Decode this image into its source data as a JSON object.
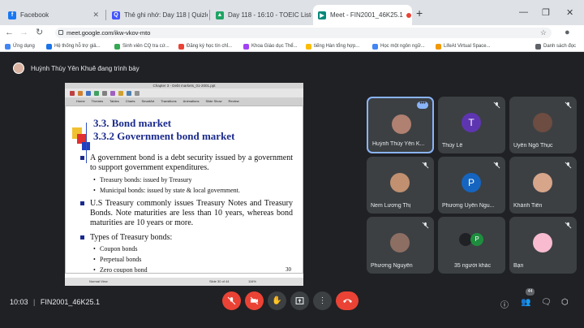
{
  "tabs": [
    {
      "title": "Facebook",
      "icon": "facebook-icon",
      "color": "#1877f2",
      "glyph": "f"
    },
    {
      "title": "Thẻ ghi nhớ: Day 118 | Quizlet",
      "icon": "quizlet-icon",
      "color": "#4255ff",
      "glyph": "Q"
    },
    {
      "title": "Day 118 - 16:10 - TOEIC Listening",
      "icon": "drive-icon",
      "color": "#1fa463",
      "glyph": "▲"
    },
    {
      "title": "Meet - FIN2001_46K25.1",
      "icon": "meet-icon",
      "color": "#00897b",
      "glyph": "▶"
    }
  ],
  "address": {
    "url": "meet.google.com/ikw-vkov-mto"
  },
  "bookmarks": [
    {
      "label": "Ứng dụng",
      "color": "#4285f4"
    },
    {
      "label": "Hệ thống hỗ trợ giả...",
      "color": "#1a73e8"
    },
    {
      "label": "Sinh viên CQ tra cứ...",
      "color": "#34a853"
    },
    {
      "label": "Đăng ký học tín chỉ...",
      "color": "#ea4335"
    },
    {
      "label": "Khoa Giáo dục Thể...",
      "color": "#a142f4"
    },
    {
      "label": "tiếng Hàn tổng hợp...",
      "color": "#fbbc04"
    },
    {
      "label": "Học một ngôn ngữ...",
      "color": "#4285f4"
    },
    {
      "label": "LifeAt Virtual Space...",
      "color": "#f29900"
    },
    {
      "label": "Danh sách đọc",
      "color": "#5f6368"
    }
  ],
  "banner": "Huỳnh Thùy Yên Khuê đang trình bày",
  "slide": {
    "window_title": "Chapter 3 - Debt markets_01-2001.ppt",
    "ribbon": [
      "Home",
      "Themes",
      "Tables",
      "Charts",
      "SmartArt",
      "Transitions",
      "Animations",
      "Slide Show",
      "Review"
    ],
    "h1": "3.3. Bond market",
    "h2": "3.3.2 Government bond market",
    "b1": "A government bond is a debt security issued by a government to support government expenditures.",
    "s1": "Treasury bonds: issued by Treasury",
    "s2": "Municipal bonds: issued by state & local government.",
    "b2": "U.S Treasury commonly issues Treasury Notes and Treasury Bonds. Note maturities are less than 10 years, whereas bond maturities are 10 years or more.",
    "b3": "Types of Treasury bonds:",
    "s3": "Coupon bonds",
    "s4": "Perpetual bonds",
    "s5": "Zero coupon bond",
    "page": "30",
    "status_view": "Normal View",
    "status_slide": "Slide 30 of 44",
    "status_zoom": "116%"
  },
  "participants": [
    {
      "name": "Huỳnh Thùy Yên K...",
      "avatar": "photo",
      "color": "#b08070",
      "speaking": true
    },
    {
      "name": "Thùy Lê",
      "avatar": "T",
      "color": "#5e35b1"
    },
    {
      "name": "Uyên Ngô Thục",
      "avatar": "photo",
      "color": "#6d4c41"
    },
    {
      "name": "Nem Lương Thị",
      "avatar": "photo",
      "color": "#c09070"
    },
    {
      "name": "Phương Uyên Ngu...",
      "avatar": "P",
      "color": "#1565c0"
    },
    {
      "name": "Khánh Tiên",
      "avatar": "photo",
      "color": "#d7a58a"
    },
    {
      "name": "Phương Nguyễn",
      "avatar": "photo",
      "color": "#8d6e63"
    },
    {
      "name": "35 người khác",
      "avatar": "group",
      "color": "#1e8e3e"
    },
    {
      "name": "Bạn",
      "avatar": "photo",
      "color": "#f8bbd0"
    }
  ],
  "bottom": {
    "time": "10:03",
    "meeting": "FIN2001_46K25.1",
    "people_count": "44"
  }
}
